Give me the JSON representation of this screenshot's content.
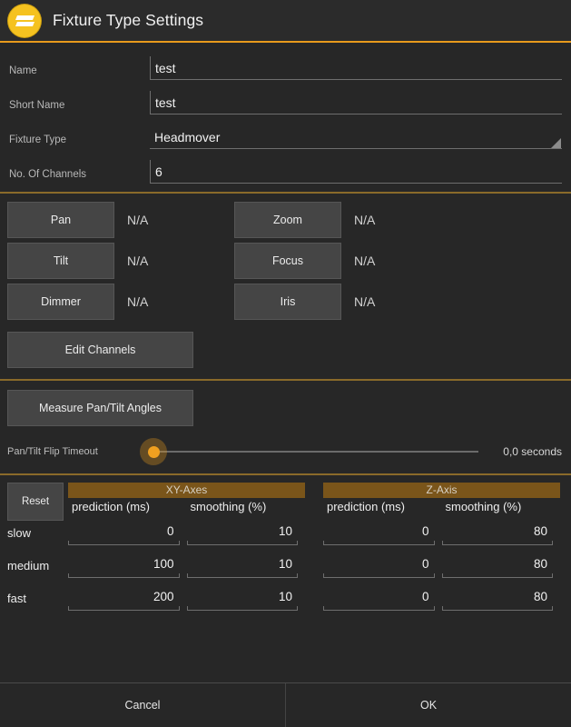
{
  "header": {
    "title": "Fixture Type Settings",
    "logo_icon": "zactrack-z-logo-icon"
  },
  "form": {
    "fields": [
      {
        "label": "Name",
        "value": "test",
        "type": "text"
      },
      {
        "label": "Short Name",
        "value": "test",
        "type": "text"
      },
      {
        "label": "Fixture Type",
        "value": "Headmover",
        "type": "spinner"
      },
      {
        "label": "No. Of Channels",
        "value": "6",
        "type": "text"
      }
    ]
  },
  "channels": {
    "rows": [
      {
        "left_label": "Pan",
        "left_value": "N/A",
        "right_label": "Zoom",
        "right_value": "N/A"
      },
      {
        "left_label": "Tilt",
        "left_value": "N/A",
        "right_label": "Focus",
        "right_value": "N/A"
      },
      {
        "left_label": "Dimmer",
        "left_value": "N/A",
        "right_label": "Iris",
        "right_value": "N/A"
      }
    ],
    "edit_channels_label": "Edit Channels"
  },
  "measure": {
    "button_label": "Measure Pan/Tilt Angles",
    "slider_label": "Pan/Tilt Flip Timeout",
    "slider_value_text": "0,0 seconds"
  },
  "tuning": {
    "reset_label": "Reset",
    "groups": [
      {
        "name": "XY-Axes",
        "columns": [
          "prediction (ms)",
          "smoothing (%)"
        ]
      },
      {
        "name": "Z-Axis",
        "columns": [
          "prediction (ms)",
          "smoothing (%)"
        ]
      }
    ],
    "rows": [
      {
        "label": "slow",
        "xy_prediction": "0",
        "xy_smoothing": "10",
        "z_prediction": "0",
        "z_smoothing": "80"
      },
      {
        "label": "medium",
        "xy_prediction": "100",
        "xy_smoothing": "10",
        "z_prediction": "0",
        "z_smoothing": "80"
      },
      {
        "label": "fast",
        "xy_prediction": "200",
        "xy_smoothing": "10",
        "z_prediction": "0",
        "z_smoothing": "80"
      }
    ]
  },
  "footer": {
    "cancel_label": "Cancel",
    "ok_label": "OK"
  },
  "colors": {
    "background": "#272727",
    "accent_orange": "#e89a1c",
    "logo_yellow": "#f5c220",
    "group_band_brown": "#7a551a",
    "button_face": "#454545"
  }
}
